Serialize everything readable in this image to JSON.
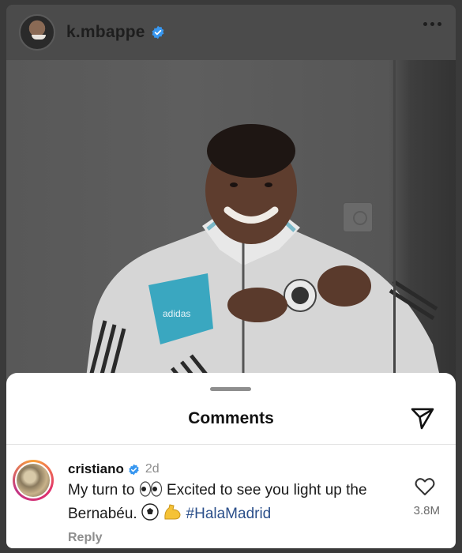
{
  "post": {
    "username": "k.mbappe",
    "verified_icon": "verified-badge-icon",
    "menu_icon": "more-options-icon"
  },
  "comments_sheet": {
    "title": "Comments",
    "share_icon": "send-icon"
  },
  "comment": {
    "user": "cristiano",
    "time": "2d",
    "text_part1": "My turn to",
    "text_part2": "Excited to see you light up the Bernabéu.",
    "hashtag": "#HalaMadrid",
    "reply_label": "Reply",
    "like_count": "3.8M"
  },
  "colors": {
    "verified_blue": "#3897f0",
    "hashtag": "#2b4f8a",
    "muted": "#8e8e8e"
  }
}
